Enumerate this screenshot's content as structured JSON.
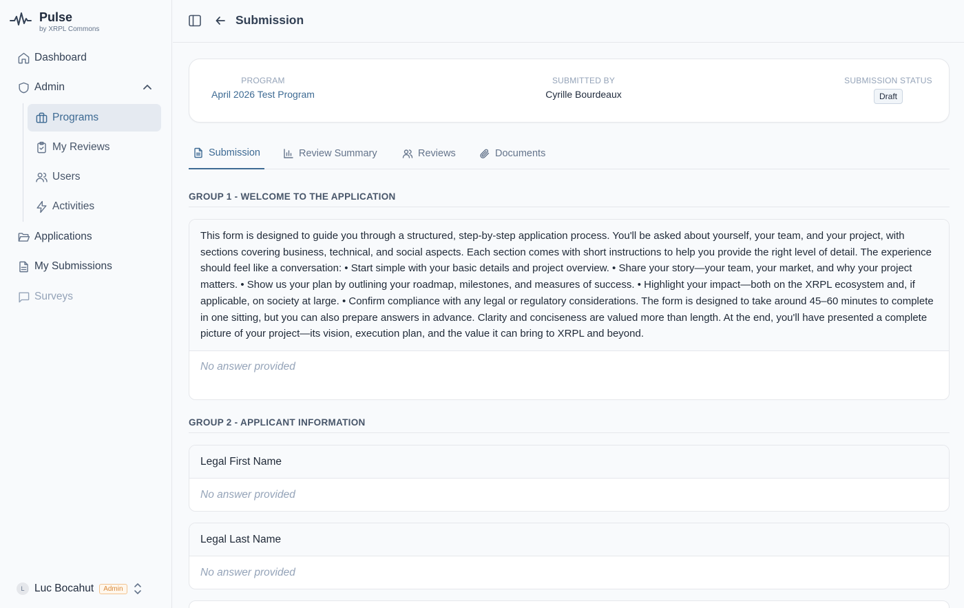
{
  "brand": {
    "name": "Pulse",
    "subtitle": "by XRPL Commons"
  },
  "sidebar": {
    "items": [
      {
        "label": "Dashboard",
        "icon": "home-icon"
      },
      {
        "label": "Admin",
        "icon": "shield-icon",
        "expanded": true
      },
      {
        "label": "Programs",
        "icon": "briefcase-icon",
        "active": true
      },
      {
        "label": "My Reviews",
        "icon": "clipboard-check-icon"
      },
      {
        "label": "Users",
        "icon": "users-icon"
      },
      {
        "label": "Activities",
        "icon": "zap-icon"
      },
      {
        "label": "Applications",
        "icon": "folder-open-icon"
      },
      {
        "label": "My Submissions",
        "icon": "file-text-icon"
      },
      {
        "label": "Surveys",
        "icon": "message-square-icon"
      }
    ],
    "user": {
      "initial": "L",
      "name": "Luc Bocahut",
      "role_badge": "Admin"
    }
  },
  "header": {
    "title": "Submission"
  },
  "meta": {
    "program_label": "PROGRAM",
    "program_value": "April 2026 Test Program",
    "submitted_by_label": "SUBMITTED BY",
    "submitted_by_value": "Cyrille Bourdeaux",
    "status_label": "SUBMISSION STATUS",
    "status_value": "Draft"
  },
  "tabs": [
    {
      "label": "Submission",
      "icon": "file-icon",
      "active": true
    },
    {
      "label": "Review Summary",
      "icon": "bar-chart-icon"
    },
    {
      "label": "Reviews",
      "icon": "users-icon"
    },
    {
      "label": "Documents",
      "icon": "paperclip-icon"
    }
  ],
  "groups": [
    {
      "title": "GROUP 1 - WELCOME TO THE APPLICATION",
      "questions": [
        {
          "text": "This form is designed to guide you through a structured, step-by-step application process. You'll be asked about yourself, your team, and your project, with sections covering business, technical, and social aspects. Each section comes with short instructions to help you provide the right level of detail. The experience should feel like a conversation: • Start simple with your basic details and project overview. • Share your story—your team, your market, and why your project matters. • Show us your plan by outlining your roadmap, milestones, and measures of success. • Highlight your impact—both on the XRPL ecosystem and, if applicable, on society at large. • Confirm compliance with any legal or regulatory considerations. The form is designed to take around 45–60 minutes to complete in one sitting, but you can also prepare answers in advance. Clarity and conciseness are valued more than length. At the end, you'll have presented a complete picture of your project—its vision, execution plan, and the value it can bring to XRPL and beyond.",
          "answer": "No answer provided"
        }
      ]
    },
    {
      "title": "GROUP 2 - APPLICANT INFORMATION",
      "questions": [
        {
          "text": "Legal First Name",
          "answer": "No answer provided"
        },
        {
          "text": "Legal Last Name",
          "answer": "No answer provided"
        }
      ]
    }
  ],
  "colors": {
    "accent": "#3d6a93",
    "muted": "#94a3b8",
    "border": "#e5e7eb"
  }
}
